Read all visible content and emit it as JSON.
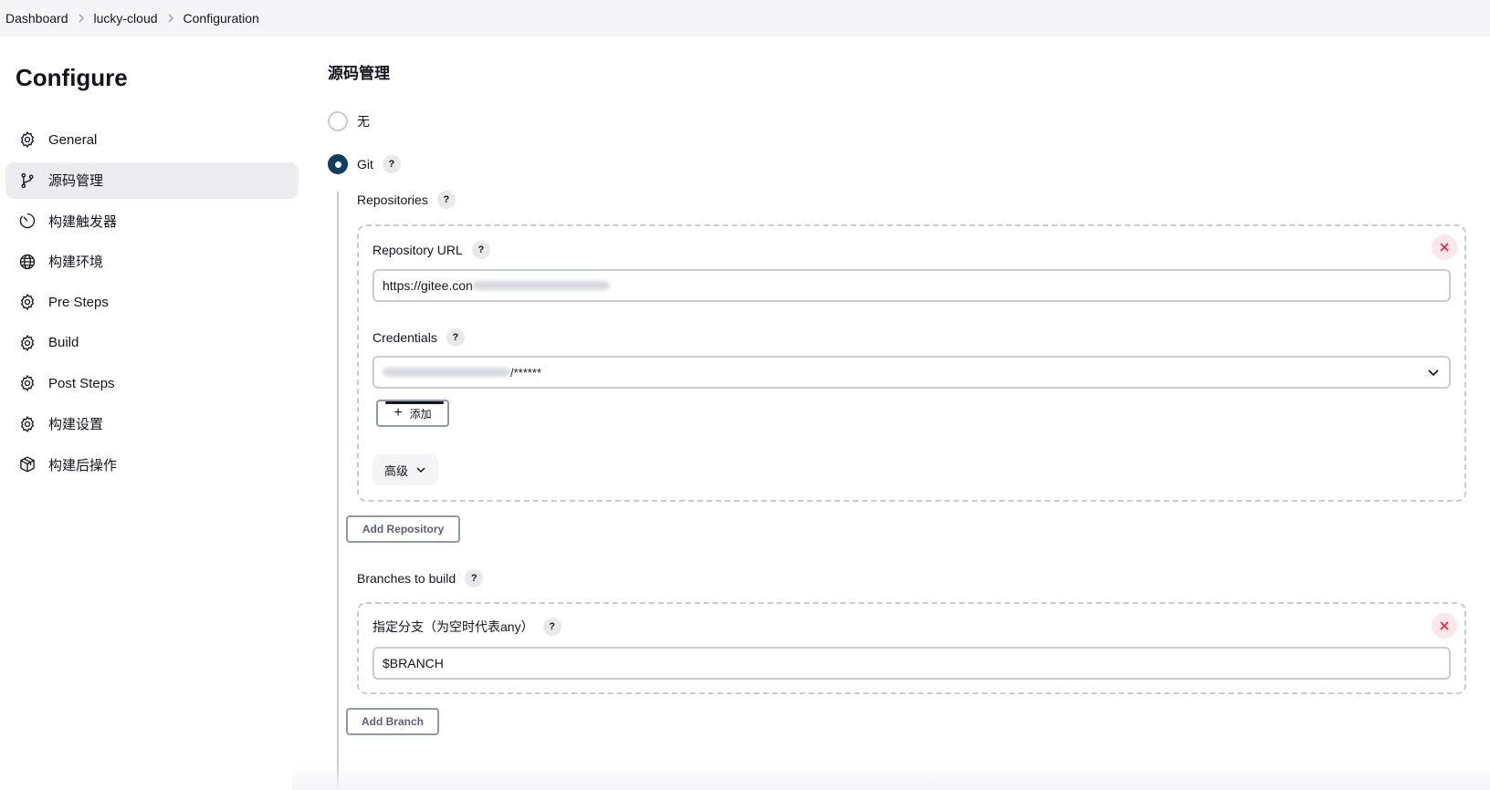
{
  "breadcrumb": [
    {
      "label": "Dashboard"
    },
    {
      "label": "lucky-cloud"
    },
    {
      "label": "Configuration"
    }
  ],
  "sidebar": {
    "title": "Configure",
    "items": [
      {
        "label": "General",
        "icon": "gear-icon",
        "active": false
      },
      {
        "label": "源码管理",
        "icon": "git-branch-icon",
        "active": true
      },
      {
        "label": "构建触发器",
        "icon": "timer-icon",
        "active": false
      },
      {
        "label": "构建环境",
        "icon": "globe-icon",
        "active": false
      },
      {
        "label": "Pre Steps",
        "icon": "gear-icon",
        "active": false
      },
      {
        "label": "Build",
        "icon": "gear-icon",
        "active": false
      },
      {
        "label": "Post Steps",
        "icon": "gear-icon",
        "active": false
      },
      {
        "label": "构建设置",
        "icon": "gear-icon",
        "active": false
      },
      {
        "label": "构建后操作",
        "icon": "package-icon",
        "active": false
      }
    ]
  },
  "scm": {
    "title": "源码管理",
    "options": [
      {
        "label": "无",
        "checked": false
      },
      {
        "label": "Git",
        "checked": true,
        "help": "?"
      }
    ],
    "repositories": {
      "label": "Repositories",
      "help": "?",
      "repository_url": {
        "label": "Repository URL",
        "help": "?",
        "value_visible": "https://gitee.con",
        "value_obscured": true
      },
      "credentials": {
        "label": "Credentials",
        "help": "?",
        "selected_visible": "/******",
        "selected_obscured": true
      },
      "add_label": "添加",
      "advanced_label": "高级",
      "add_repository_label": "Add Repository"
    },
    "branches": {
      "label": "Branches to build",
      "help": "?",
      "specifier_label": "指定分支（为空时代表any）",
      "specifier_help": "?",
      "specifier_value": "$BRANCH",
      "add_branch_label": "Add Branch"
    }
  },
  "colors": {
    "radio_checked": "#123d63",
    "delete_icon": "#e6233a",
    "delete_bg": "#fde7ea",
    "active_nav_bg": "#ebebf0",
    "topbar_bg": "#f5f5f7"
  }
}
